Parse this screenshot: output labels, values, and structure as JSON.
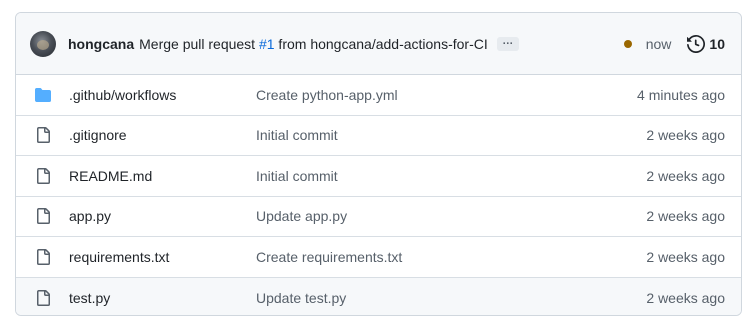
{
  "latest_commit": {
    "author": "hongcana",
    "message_prefix": "Merge pull request ",
    "pr_ref": "#1",
    "message_suffix": " from hongcana/add-actions-for-CI",
    "ellipsis": "…",
    "status_color": "#9a6700",
    "time": "now",
    "history_count": "10"
  },
  "files": [
    {
      "name": ".github/workflows",
      "type": "folder",
      "commit": "Create python-app.yml",
      "age": "4 minutes ago"
    },
    {
      "name": ".gitignore",
      "type": "file",
      "commit": "Initial commit",
      "age": "2 weeks ago"
    },
    {
      "name": "README.md",
      "type": "file",
      "commit": "Initial commit",
      "age": "2 weeks ago"
    },
    {
      "name": "app.py",
      "type": "file",
      "commit": "Update app.py",
      "age": "2 weeks ago"
    },
    {
      "name": "requirements.txt",
      "type": "file",
      "commit": "Create requirements.txt",
      "age": "2 weeks ago"
    },
    {
      "name": "test.py",
      "type": "file",
      "commit": "Update test.py",
      "age": "2 weeks ago"
    }
  ],
  "icons": {
    "folder": "folder-icon",
    "file": "file-icon",
    "history": "history-icon"
  }
}
